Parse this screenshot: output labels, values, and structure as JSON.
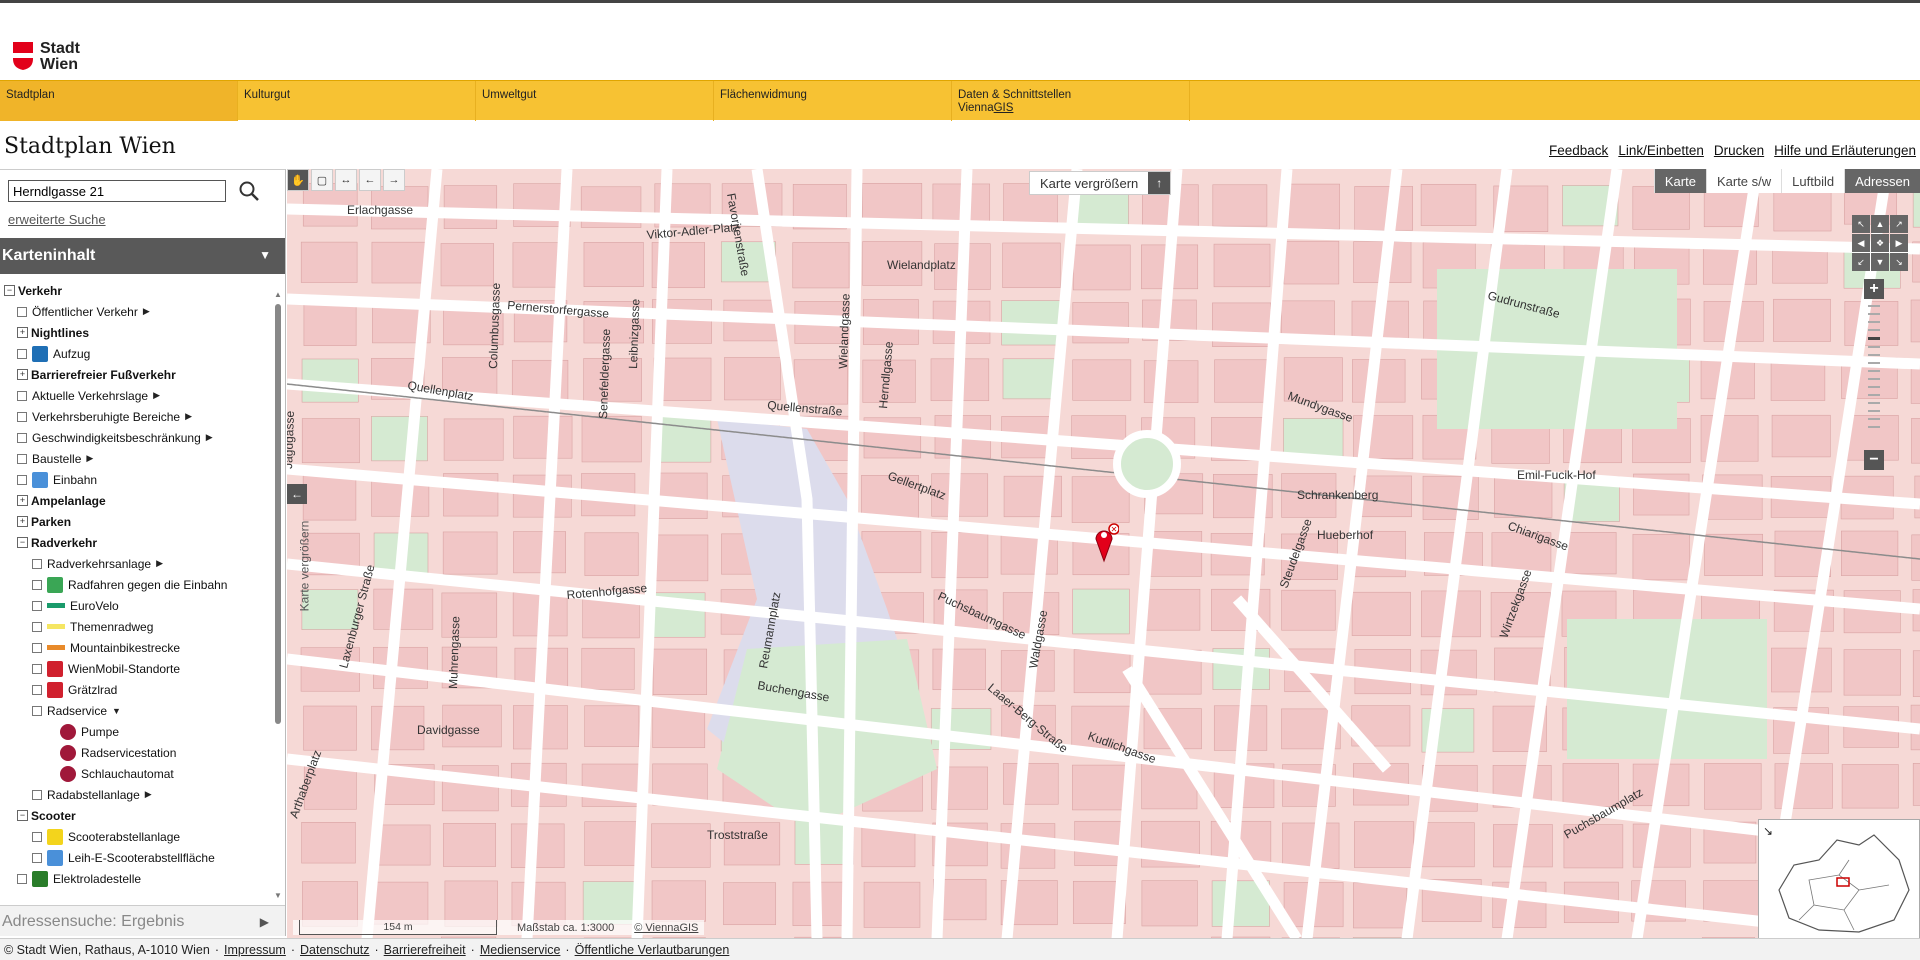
{
  "brand": {
    "line1": "Stadt",
    "line2": "Wien",
    "logo_icon": "vienna-shield-icon",
    "accent": "#e2001a"
  },
  "nav": {
    "items": [
      {
        "label": "Stadtplan",
        "sub": ""
      },
      {
        "label": "Kulturgut",
        "sub": ""
      },
      {
        "label": "Umweltgut",
        "sub": ""
      },
      {
        "label": "Flächenwidmung",
        "sub": ""
      },
      {
        "label": "Daten & Schnittstellen",
        "sub": "Vienna",
        "sub_gis": "GIS"
      }
    ],
    "color": "#f7c233"
  },
  "page": {
    "title": "Stadtplan Wien"
  },
  "top_links": [
    "Feedback",
    "Link/Einbetten",
    "Drucken",
    "Hilfe und Erläuterungen"
  ],
  "search": {
    "value": "Herndlgasse 21",
    "advanced": "erweiterte Suche",
    "icon": "search-icon"
  },
  "panel": {
    "title": "Karteninhalt",
    "result_title": "Adressensuche: Ergebnis"
  },
  "tree": [
    {
      "label": "Verkehr",
      "bold": true,
      "toggle": "−",
      "indent": 0
    },
    {
      "label": "Öffentlicher Verkehr",
      "arrow": true,
      "cb": true,
      "indent": 1
    },
    {
      "label": "Nightlines",
      "bold": true,
      "toggle": "+",
      "indent": 1
    },
    {
      "label": "Aufzug",
      "cb": true,
      "icon": "elevator-icon",
      "icon_color": "#1f6fb5",
      "indent": 1
    },
    {
      "label": "Barrierefreier Fußverkehr",
      "bold": true,
      "toggle": "+",
      "indent": 1
    },
    {
      "label": "Aktuelle Verkehrslage",
      "arrow": true,
      "cb": true,
      "indent": 1
    },
    {
      "label": "Verkehrsberuhigte Bereiche",
      "arrow": true,
      "cb": true,
      "indent": 1
    },
    {
      "label": "Geschwindigkeitsbeschränkung",
      "arrow": true,
      "cb": true,
      "indent": 1
    },
    {
      "label": "Baustelle",
      "arrow": true,
      "cb": true,
      "indent": 1
    },
    {
      "label": "Einbahn",
      "cb": true,
      "icon": "one-way-arrow-icon",
      "icon_color": "#4a90d9",
      "indent": 1
    },
    {
      "label": "Ampelanlage",
      "bold": true,
      "toggle": "+",
      "indent": 1
    },
    {
      "label": "Parken",
      "bold": true,
      "toggle": "+",
      "indent": 1
    },
    {
      "label": "Radverkehr",
      "bold": true,
      "toggle": "−",
      "indent": 1
    },
    {
      "label": "Radverkehrsanlage",
      "arrow": true,
      "cb": true,
      "indent": 2
    },
    {
      "label": "Radfahren gegen die Einbahn",
      "cb": true,
      "icon": "contra-flow-icon",
      "icon_color": "#3aa655",
      "indent": 2
    },
    {
      "label": "EuroVelo",
      "cb": true,
      "icon": "eurovelo-line-icon",
      "icon_color": "#1a9b6b",
      "indent": 2
    },
    {
      "label": "Themenradweg",
      "cb": true,
      "icon": "theme-route-line-icon",
      "icon_color": "#f5e663",
      "indent": 2
    },
    {
      "label": "Mountainbikestrecke",
      "cb": true,
      "icon": "mtb-line-icon",
      "icon_color": "#e88a2a",
      "indent": 2
    },
    {
      "label": "WienMobil-Standorte",
      "cb": true,
      "icon": "wienmobil-icon",
      "icon_color": "#d0202e",
      "indent": 2
    },
    {
      "label": "Grätzlrad",
      "cb": true,
      "icon": "cargo-bike-icon",
      "icon_color": "#d0202e",
      "indent": 2
    },
    {
      "label": "Radservice",
      "arrow_down": true,
      "cb": true,
      "indent": 2
    },
    {
      "label": "Pumpe",
      "icon": "pump-icon",
      "icon_color": "#a0183a",
      "indent": 3
    },
    {
      "label": "Radservicestation",
      "icon": "service-station-icon",
      "icon_color": "#a0183a",
      "indent": 3
    },
    {
      "label": "Schlauchautomat",
      "icon": "tube-vending-icon",
      "icon_color": "#a0183a",
      "indent": 3
    },
    {
      "label": "Radabstellanlage",
      "arrow": true,
      "cb": true,
      "indent": 2
    },
    {
      "label": "Scooter",
      "bold": true,
      "toggle": "−",
      "indent": 1
    },
    {
      "label": "Scooterabstellanlage",
      "cb": true,
      "icon": "scooter-parking-icon",
      "icon_color": "#f3d41c",
      "indent": 2
    },
    {
      "label": "Leih-E-Scooterabstellfläche",
      "cb": true,
      "icon": "e-scooter-icon",
      "icon_color": "#4a90d9",
      "indent": 2
    },
    {
      "label": "Elektroladestelle",
      "cb": true,
      "icon": "charging-station-icon",
      "icon_color": "#2a7d2a",
      "indent": 1
    }
  ],
  "map": {
    "enlarge_label": "Karte vergrößern",
    "side_label": "Karte vergrößern",
    "types": [
      "Karte",
      "Karte s/w",
      "Luftbild",
      "Adressen"
    ],
    "selected_types": [
      "Karte",
      "Adressen"
    ],
    "scale_text": "154 m",
    "scale_label": "Maßstab ca. 1:3000",
    "copyright": "© ViennaGIS",
    "streets": [
      "Erlachgasse",
      "Viktor-Adler-Platz",
      "Favoritenstraße",
      "Wielandplatz",
      "Wielandgasse",
      "Pernerstorfergasse",
      "Quellenplatz",
      "Quellenstraße",
      "Herndlgasse",
      "Gellertplatz",
      "Buchengasse",
      "Rotenhofgasse",
      "Davidgasse",
      "Laxenburger Straße",
      "Puchsbaumgasse",
      "Laaer-Berg-Straße",
      "Kudlichgasse",
      "Mundygasse",
      "Gudrunstraße",
      "Steudelgasse",
      "Reumannplatz",
      "Waldgasse",
      "Hueberhof",
      "Schrankenberg",
      "Emil-Fucik-Hof",
      "Columbusgasse",
      "Leibnizgasse",
      "Senefeldergasse",
      "Muhrengasse",
      "Jagdgasse",
      "Arthaberplatz",
      "Chiarigasse",
      "Wirtzekgasse",
      "Puchsbaumplatz",
      "Troststraße"
    ],
    "colors": {
      "building": "#f1c6c6",
      "block": "#f6d9d6",
      "green": "#d5ead2",
      "street": "#ffffff",
      "plaza": "#dcdcec"
    }
  },
  "footer": {
    "text": "© Stadt Wien, Rathaus, A-1010 Wien",
    "links": [
      "Impressum",
      "Datenschutz",
      "Barrierefreiheit",
      "Medienservice",
      "Öffentliche Verlautbarungen"
    ]
  }
}
